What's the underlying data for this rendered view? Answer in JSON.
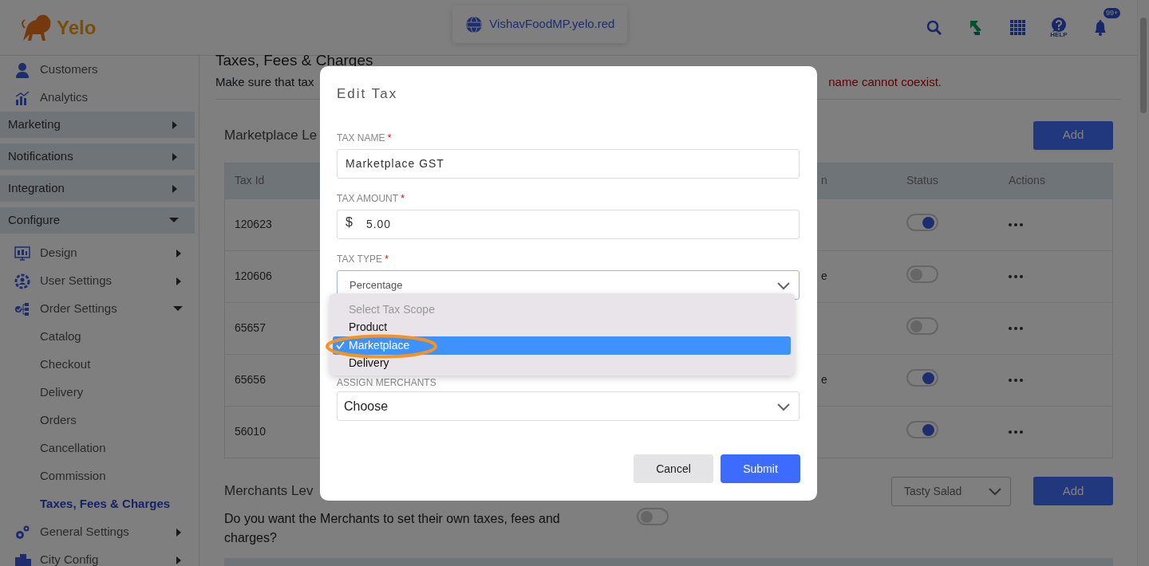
{
  "header": {
    "logo": "Yelo",
    "domain": "VishavFoodMP.yelo.red",
    "help_label": "HELP",
    "notification_badge": "99+"
  },
  "sidebar": {
    "items": [
      {
        "kind": "link",
        "label": "Customers"
      },
      {
        "kind": "link",
        "label": "Analytics"
      },
      {
        "kind": "section",
        "label": "Marketing",
        "expanded": false
      },
      {
        "kind": "section",
        "label": "Notifications",
        "expanded": false
      },
      {
        "kind": "section",
        "label": "Integration",
        "expanded": false
      },
      {
        "kind": "section",
        "label": "Configure",
        "expanded": true,
        "children": [
          {
            "label": "Design",
            "expanded": false
          },
          {
            "label": "User Settings",
            "expanded": false
          },
          {
            "label": "Order Settings",
            "expanded": true,
            "children": [
              {
                "label": "Catalog",
                "selected": false
              },
              {
                "label": "Checkout",
                "selected": false
              },
              {
                "label": "Delivery",
                "selected": false
              },
              {
                "label": "Orders",
                "selected": false
              },
              {
                "label": "Cancellation",
                "selected": false
              },
              {
                "label": "Commission",
                "selected": false
              },
              {
                "label": "Taxes, Fees & Charges",
                "selected": true
              }
            ]
          },
          {
            "label": "General Settings",
            "expanded": false
          },
          {
            "label": "City Config",
            "expanded": false
          }
        ]
      }
    ]
  },
  "main": {
    "title": "Taxes, Fees & Charges",
    "notice_start": "Make sure that tax",
    "notice_end": "name cannot coexist.",
    "marketplace": {
      "heading": "Marketplace Le",
      "add_button": "Add",
      "table": {
        "columns": [
          "Tax Id",
          "n",
          "Status",
          "Actions"
        ],
        "rows": [
          {
            "tax_id": "120623",
            "status_on": true
          },
          {
            "tax_id": "120606",
            "column_2": "e",
            "status_on": false
          },
          {
            "tax_id": "65657",
            "status_on": false
          },
          {
            "tax_id": "65656",
            "column_2": "e",
            "status_on": true
          },
          {
            "tax_id": "56010",
            "status_on": true
          }
        ]
      }
    },
    "merchants": {
      "heading": "Merchants Lev",
      "merchant_select": "Tasty Salad",
      "add_button": "Add",
      "question": "Do you want the Merchants to set their own taxes, fees and charges?",
      "toggle_on": false
    }
  },
  "modal": {
    "title": "Edit Tax",
    "fields": [
      {
        "kind": "text",
        "label": "TAX NAME",
        "required_mark": "*",
        "value": "Marketplace GST"
      },
      {
        "kind": "amount",
        "label": "TAX AMOUNT",
        "required_mark": "*",
        "prefix": "$",
        "value": "5.00"
      },
      {
        "kind": "select",
        "label": "TAX TYPE",
        "required_mark": "*",
        "value": "Percentage",
        "focused": true
      },
      {
        "kind": "select",
        "label": "ASSIGN MERCHANTS",
        "value": "Choose",
        "focused": false
      }
    ],
    "dropdown": {
      "options": [
        {
          "label": "Select Tax Scope",
          "disabled": true,
          "selected": false,
          "circled": false
        },
        {
          "label": "Product",
          "disabled": false,
          "selected": false,
          "circled": false
        },
        {
          "label": "Marketplace",
          "disabled": false,
          "selected": true,
          "circled": true
        },
        {
          "label": "Delivery",
          "disabled": false,
          "selected": false,
          "circled": false
        }
      ]
    },
    "cancel_button": "Cancel",
    "submit_button": "Submit"
  }
}
